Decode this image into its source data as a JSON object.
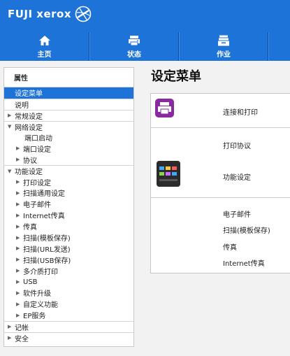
{
  "brand": {
    "name": "FUJI xerox"
  },
  "nav": {
    "tabs": [
      {
        "label": "主页",
        "icon": "home-icon"
      },
      {
        "label": "状态",
        "icon": "status-icon"
      },
      {
        "label": "作业",
        "icon": "job-icon"
      }
    ]
  },
  "sidebar": {
    "header": "属性",
    "items": [
      {
        "label": "设定菜单",
        "selected": true
      },
      {
        "label": "说明"
      },
      {
        "label": "常规设定",
        "arrow": "right"
      },
      {
        "label": "网络设定",
        "arrow": "down"
      },
      {
        "label": "端口启动"
      },
      {
        "label": "端口设定",
        "arrow": "right"
      },
      {
        "label": "协议",
        "arrow": "right"
      },
      {
        "label": "功能设定",
        "arrow": "down"
      },
      {
        "label": "打印设定",
        "arrow": "right"
      },
      {
        "label": "扫描通用设定",
        "arrow": "right"
      },
      {
        "label": "电子邮件",
        "arrow": "right"
      },
      {
        "label": "Internet传真",
        "arrow": "right"
      },
      {
        "label": "传真",
        "arrow": "right"
      },
      {
        "label": "扫描(模板保存)",
        "arrow": "right"
      },
      {
        "label": "扫描(URL发送)",
        "arrow": "right"
      },
      {
        "label": "扫描(USB保存)",
        "arrow": "right"
      },
      {
        "label": "多介质打印",
        "arrow": "right"
      },
      {
        "label": "USB",
        "arrow": "right"
      },
      {
        "label": "软件升级",
        "arrow": "right"
      },
      {
        "label": "自定义功能",
        "arrow": "right"
      },
      {
        "label": "EP服务",
        "arrow": "right"
      },
      {
        "label": "记帐",
        "arrow": "right"
      },
      {
        "label": "安全",
        "arrow": "right"
      }
    ]
  },
  "main": {
    "title": "设定菜单",
    "sections": [
      {
        "links": [
          "连接和打印"
        ],
        "icon": "printer-icon"
      },
      {
        "links": [
          "打印协议",
          "功能设定"
        ],
        "icon": "function-settings-icon"
      },
      {
        "links": [
          "电子邮件",
          "扫描(模板保存)",
          "传真",
          "Internet传真"
        ]
      }
    ]
  },
  "colors": {
    "accent": "#1e73d8",
    "printer_icon": "#8a2aa0"
  }
}
